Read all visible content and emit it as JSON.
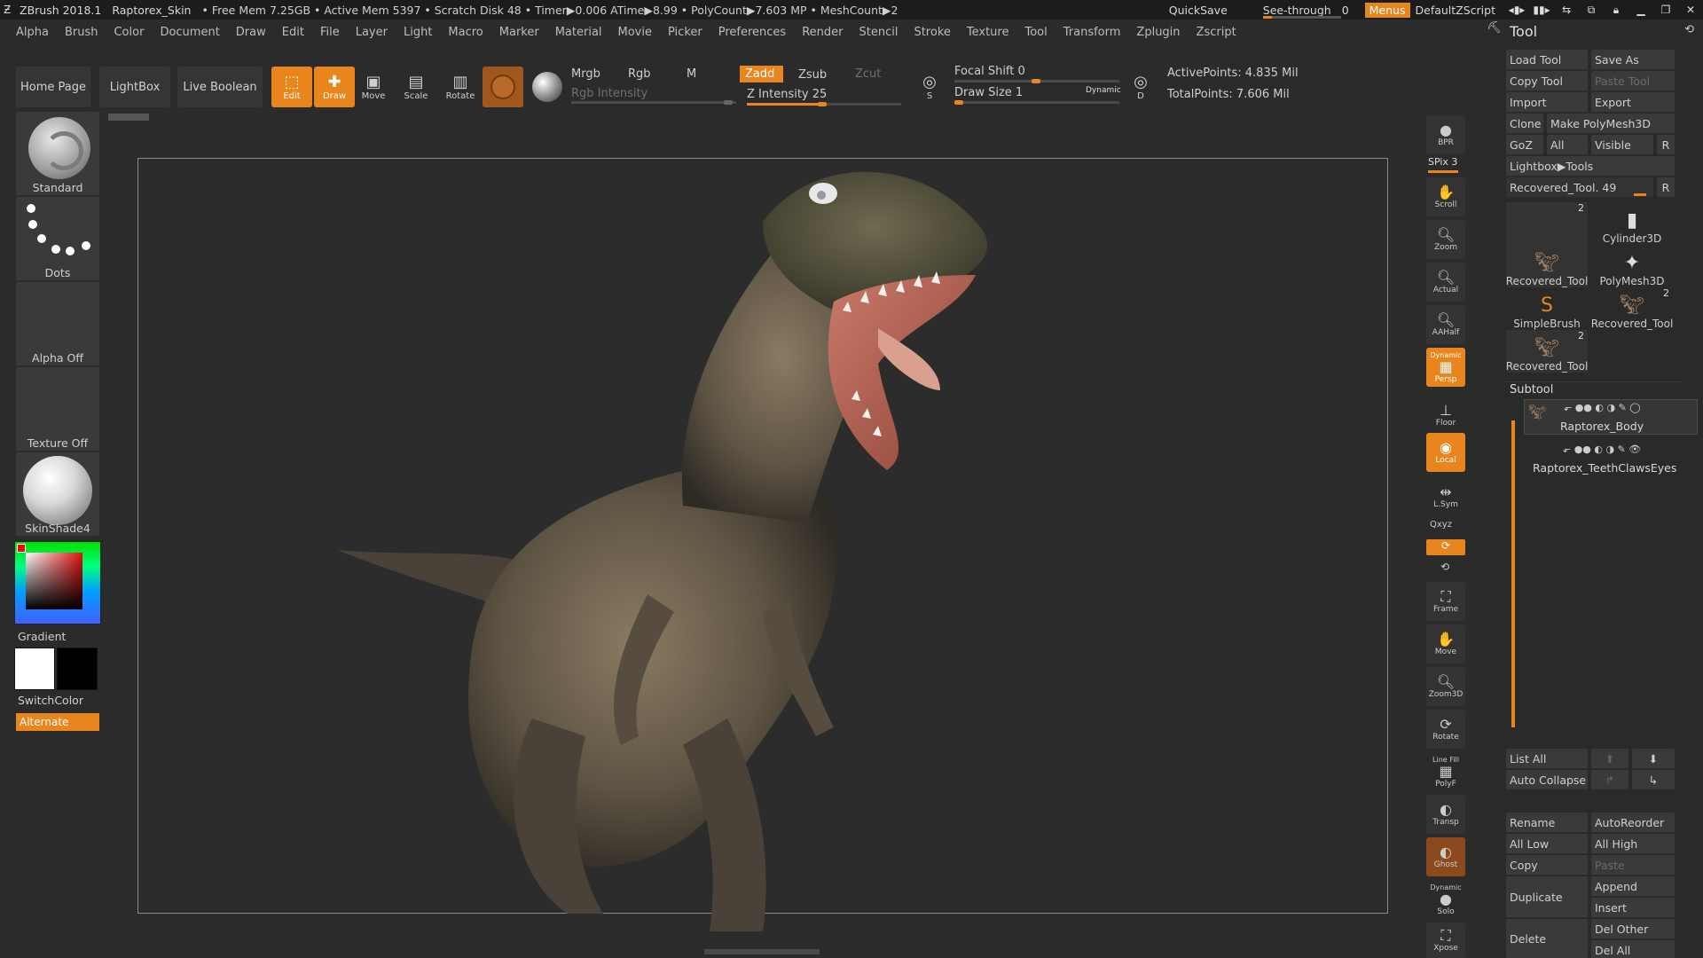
{
  "titlebar": {
    "app": "ZBrush 2018.1",
    "document": "Raptorex_Skin",
    "stats": "• Free Mem 7.25GB • Active Mem 5397 • Scratch Disk 48 • Timer▶0.006 ATime▶8.99 • PolyCount▶7.603 MP • MeshCount▶2",
    "quicksave": "QuickSave",
    "seethrough": "See-through",
    "seethrough_value": "0",
    "menus": "Menus",
    "script": "DefaultZScript"
  },
  "menubar": [
    "Alpha",
    "Brush",
    "Color",
    "Document",
    "Draw",
    "Edit",
    "File",
    "Layer",
    "Light",
    "Macro",
    "Marker",
    "Material",
    "Movie",
    "Picker",
    "Preferences",
    "Render",
    "Stencil",
    "Stroke",
    "Texture",
    "Tool",
    "Transform",
    "Zplugin",
    "Zscript"
  ],
  "toolbar": {
    "home_page": "Home Page",
    "lightbox": "LightBox",
    "live_boolean": "Live Boolean",
    "edit": "Edit",
    "draw": "Draw",
    "move": "Move",
    "scale": "Scale",
    "rotate": "Rotate",
    "mrgb": "Mrgb",
    "rgb": "Rgb",
    "m": "M",
    "rgb_intensity": "Rgb Intensity",
    "zadd": "Zadd",
    "zsub": "Zsub",
    "zcut": "Zcut",
    "z_intensity": "Z Intensity 25",
    "focal_shift": "Focal Shift 0",
    "draw_size": "Draw Size 1",
    "dynamic": "Dynamic",
    "active_points": "ActivePoints: 4.835 Mil",
    "total_points": "TotalPoints: 7.606 Mil",
    "s_label": "S",
    "d_label": "D"
  },
  "left": {
    "standard": "Standard",
    "dots": "Dots",
    "alpha": "Alpha Off",
    "texture": "Texture Off",
    "material": "SkinShade4",
    "gradient": "Gradient",
    "switchcolor": "SwitchColor",
    "alternate": "Alternate"
  },
  "rightbar": {
    "bpr": "BPR",
    "spix": "SPix 3",
    "scroll": "Scroll",
    "zoom": "Zoom",
    "actual": "Actual",
    "aahalf": "AAHalf",
    "dynamic": "Dynamic",
    "persp": "Persp",
    "floor": "Floor",
    "local": "Local",
    "lsym": "L.Sym",
    "xyz": "Qxyz",
    "frame": "Frame",
    "move": "Move",
    "zoom3d": "Zoom3D",
    "rotate": "Rotate",
    "linefill": "Line Fill",
    "polyf": "PolyF",
    "transp": "Transp",
    "ghost": "Ghost",
    "dynamic2": "Dynamic",
    "solo": "Solo",
    "xpose": "Xpose"
  },
  "toolpanel": {
    "title": "Tool",
    "load_tool": "Load Tool",
    "save_as": "Save As",
    "copy_tool": "Copy Tool",
    "paste_tool": "Paste Tool",
    "import": "Import",
    "export": "Export",
    "clone": "Clone",
    "make_polymesh": "Make PolyMesh3D",
    "goz": "GoZ",
    "all": "All",
    "visible": "Visible",
    "r": "R",
    "lightbox_tools": "Lightbox▶Tools",
    "recovered_tool": "Recovered_Tool. 49",
    "thumbs": [
      {
        "label": "Recovered_Tool",
        "num": "2"
      },
      {
        "label": "Cylinder3D",
        "num": ""
      },
      {
        "label": "PolyMesh3D",
        "num": ""
      },
      {
        "label": "SimpleBrush",
        "num": ""
      },
      {
        "label": "Recovered_Tool",
        "num": "2"
      },
      {
        "label": "Recovered_Tool",
        "num": "2"
      }
    ],
    "subtool": "Subtool",
    "subtools": [
      "Raptorex_Body",
      "Raptorex_TeethClawsEyes"
    ],
    "list_all": "List All",
    "auto_collapse": "Auto Collapse",
    "rename": "Rename",
    "autoreorder": "AutoReorder",
    "all_low": "All Low",
    "all_high": "All High",
    "copy": "Copy",
    "paste": "Paste",
    "append": "Append",
    "duplicate": "Duplicate",
    "insert": "Insert",
    "del_other": "Del Other",
    "delete": "Delete",
    "del_all": "Del All"
  },
  "colors": {
    "accent": "#e8851d",
    "panel": "#2a2a2a",
    "canvas": "#2c2c2c"
  }
}
